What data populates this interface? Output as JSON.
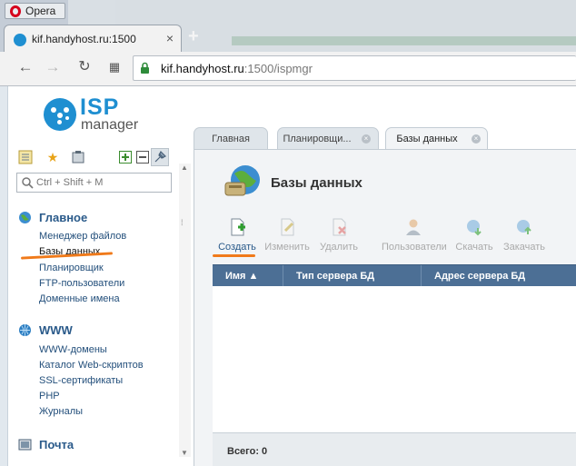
{
  "browser": {
    "menu_label": "Opera",
    "tab_title": "kif.handyhost.ru:1500",
    "tab_close": "×",
    "new_tab": "+",
    "url_host": "kif.handyhost.ru",
    "url_rest": ":1500/ispmgr"
  },
  "logo": {
    "brand": "ISP",
    "sub": "manager"
  },
  "search": {
    "placeholder": "Ctrl + Shift + M"
  },
  "sidebar": {
    "groups": [
      {
        "label": "Главное",
        "items": [
          "Менеджер файлов",
          "Базы данных",
          "Планировщик",
          "FTP-пользователи",
          "Доменные имена"
        ]
      },
      {
        "label": "WWW",
        "items": [
          "WWW-домены",
          "Каталог Web-скриптов",
          "SSL-сертификаты",
          "PHP",
          "Журналы"
        ]
      },
      {
        "label": "Почта",
        "items": []
      }
    ]
  },
  "app_tabs": [
    {
      "label": "Главная"
    },
    {
      "label": "Планировщи..."
    },
    {
      "label": "Базы данных"
    }
  ],
  "page": {
    "title": "Базы данных"
  },
  "actions": [
    {
      "label": "Создать",
      "enabled": true
    },
    {
      "label": "Изменить",
      "enabled": false
    },
    {
      "label": "Удалить",
      "enabled": false
    },
    {
      "label": "Пользователи",
      "enabled": false
    },
    {
      "label": "Скачать",
      "enabled": false
    },
    {
      "label": "Закачать",
      "enabled": false
    }
  ],
  "table": {
    "columns": [
      "Имя ▲",
      "Тип сервера БД",
      "Адрес сервера БД"
    ],
    "rows": [],
    "footer": "Всего: 0"
  },
  "colors": {
    "accent": "#1f8fd1",
    "table_header": "#4c6f95",
    "annotation": "#f07a1a"
  }
}
